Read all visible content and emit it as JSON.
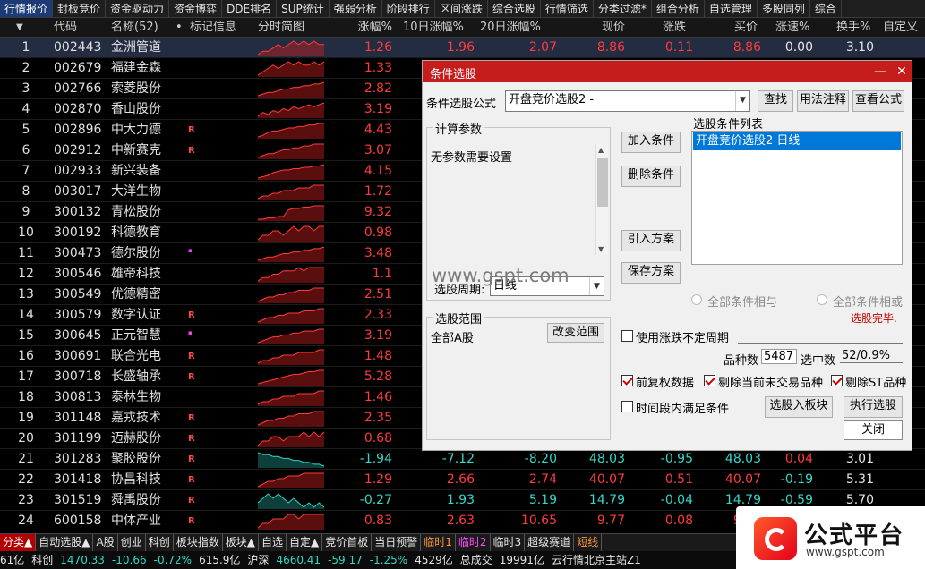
{
  "top_menu": [
    {
      "label": "行情报价",
      "active": true
    },
    {
      "label": "封板竞价"
    },
    {
      "label": "资金驱动力"
    },
    {
      "label": "资金博弈"
    },
    {
      "label": "DDE排名"
    },
    {
      "label": "SUP统计"
    },
    {
      "label": "强弱分析"
    },
    {
      "label": "阶段排行"
    },
    {
      "label": "区间涨跌"
    },
    {
      "label": "综合选股"
    },
    {
      "label": "行情筛选"
    },
    {
      "label": "分类过滤*"
    },
    {
      "label": "组合分析"
    },
    {
      "label": "自选管理"
    },
    {
      "label": "多股同列"
    },
    {
      "label": "综合"
    }
  ],
  "columns": [
    "代码",
    "名称(52)",
    "•",
    "标记信息",
    "分时简图",
    "涨幅%",
    "10日涨幅%",
    "20日涨幅%",
    "现价",
    "涨跌",
    "买价",
    "涨速%",
    "换手%",
    "自定义"
  ],
  "rows": [
    {
      "n": "1",
      "code": "002443",
      "name": "金洲管道",
      "mark": "",
      "chg": "1.26",
      "c10": "1.96",
      "c20": "2.07",
      "price": "8.86",
      "dif": "0.11",
      "bid": "8.86",
      "spd": "0.00",
      "turn": "3.10",
      "dir": "up",
      "spark": [
        3,
        4,
        4,
        5,
        6,
        5,
        6,
        7,
        6,
        7,
        6,
        7,
        6,
        6
      ]
    },
    {
      "n": "2",
      "code": "002679",
      "name": "福建金森",
      "mark": "",
      "chg": "1.33",
      "c10": "",
      "c20": "",
      "price": "",
      "dif": "",
      "bid": "",
      "spd": "",
      "turn": "",
      "dir": "up",
      "spark": [
        4,
        5,
        6,
        7,
        6,
        7,
        8,
        7,
        8,
        7,
        7,
        8,
        7,
        8
      ]
    },
    {
      "n": "3",
      "code": "002766",
      "name": "索菱股份",
      "mark": "",
      "chg": "2.82",
      "c10": "",
      "c20": "",
      "price": "",
      "dif": "",
      "bid": "",
      "spd": "",
      "turn": "",
      "dir": "up",
      "spark": [
        2,
        3,
        4,
        4,
        5,
        6,
        6,
        7,
        7,
        8,
        8,
        9,
        9,
        10
      ]
    },
    {
      "n": "4",
      "code": "002870",
      "name": "香山股份",
      "mark": "",
      "chg": "3.19",
      "c10": "",
      "c20": "",
      "price": "",
      "dif": "",
      "bid": "",
      "spd": "",
      "turn": "",
      "dir": "up",
      "spark": [
        3,
        5,
        4,
        6,
        5,
        7,
        6,
        8,
        7,
        8,
        9,
        8,
        9,
        10
      ]
    },
    {
      "n": "5",
      "code": "002896",
      "name": "中大力德",
      "mark": "R",
      "chg": "4.43",
      "c10": "",
      "c20": "",
      "price": "",
      "dif": "",
      "bid": "",
      "spd": "",
      "turn": "",
      "dir": "up",
      "spark": [
        2,
        3,
        5,
        6,
        6,
        7,
        8,
        8,
        9,
        9,
        10,
        10,
        11,
        11
      ]
    },
    {
      "n": "6",
      "code": "002912",
      "name": "中新赛克",
      "mark": "R",
      "chg": "3.07",
      "c10": "",
      "c20": "",
      "price": "",
      "dif": "",
      "bid": "",
      "spd": "",
      "turn": "",
      "dir": "up",
      "spark": [
        3,
        4,
        5,
        5,
        6,
        7,
        7,
        8,
        8,
        9,
        9,
        10,
        10,
        10
      ]
    },
    {
      "n": "7",
      "code": "002933",
      "name": "新兴装备",
      "mark": "",
      "chg": "4.15",
      "c10": "",
      "c20": "",
      "price": "",
      "dif": "",
      "bid": "",
      "spd": "",
      "turn": "",
      "dir": "up",
      "spark": [
        2,
        3,
        4,
        6,
        7,
        8,
        8,
        9,
        9,
        10,
        10,
        11,
        11,
        12
      ]
    },
    {
      "n": "8",
      "code": "003017",
      "name": "大洋生物",
      "mark": "",
      "chg": "1.72",
      "c10": "",
      "c20": "",
      "price": "",
      "dif": "",
      "bid": "",
      "spd": "",
      "turn": "",
      "dir": "up",
      "spark": [
        3,
        4,
        4,
        5,
        5,
        6,
        6,
        6,
        7,
        7,
        7,
        8,
        8,
        8
      ]
    },
    {
      "n": "9",
      "code": "300132",
      "name": "青松股份",
      "mark": "",
      "chg": "9.32",
      "c10": "",
      "c20": "",
      "price": "",
      "dif": "",
      "bid": "",
      "spd": "",
      "turn": "",
      "dir": "up",
      "spark": [
        2,
        2,
        3,
        3,
        4,
        4,
        9,
        10,
        10,
        11,
        11,
        12,
        12,
        12
      ]
    },
    {
      "n": "10",
      "code": "300192",
      "name": "科德教育",
      "mark": "",
      "chg": "0.98",
      "c10": "",
      "c20": "",
      "price": "",
      "dif": "",
      "bid": "",
      "spd": "",
      "turn": "",
      "dir": "up",
      "spark": [
        4,
        5,
        5,
        6,
        6,
        5,
        6,
        7,
        6,
        7,
        7,
        6,
        7,
        7
      ]
    },
    {
      "n": "11",
      "code": "300473",
      "name": "德尔股份",
      "mark": "dot",
      "chg": "3.48",
      "c10": "",
      "c20": "",
      "price": "",
      "dif": "",
      "bid": "",
      "spd": "",
      "turn": "",
      "dir": "up",
      "spark": [
        3,
        4,
        5,
        5,
        6,
        7,
        7,
        8,
        8,
        9,
        9,
        10,
        10,
        11
      ]
    },
    {
      "n": "12",
      "code": "300546",
      "name": "雄帝科技",
      "mark": "",
      "chg": "1.1",
      "c10": "",
      "c20": "",
      "price": "",
      "dif": "",
      "bid": "",
      "spd": "",
      "turn": "",
      "dir": "up",
      "spark": [
        3,
        4,
        4,
        5,
        5,
        6,
        6,
        6,
        7,
        6,
        7,
        7,
        7,
        7
      ]
    },
    {
      "n": "13",
      "code": "300549",
      "name": "优德精密",
      "mark": "",
      "chg": "2.51",
      "c10": "",
      "c20": "",
      "price": "",
      "dif": "",
      "bid": "",
      "spd": "",
      "turn": "",
      "dir": "up",
      "spark": [
        3,
        4,
        5,
        5,
        6,
        6,
        7,
        7,
        8,
        8,
        8,
        9,
        9,
        9
      ]
    },
    {
      "n": "14",
      "code": "300579",
      "name": "数字认证",
      "mark": "R",
      "chg": "2.33",
      "c10": "",
      "c20": "",
      "price": "",
      "dif": "",
      "bid": "",
      "spd": "",
      "turn": "",
      "dir": "up",
      "spark": [
        3,
        4,
        5,
        5,
        6,
        6,
        7,
        7,
        7,
        8,
        8,
        8,
        9,
        9
      ]
    },
    {
      "n": "15",
      "code": "300645",
      "name": "正元智慧",
      "mark": "dot",
      "chg": "3.19",
      "c10": "",
      "c20": "",
      "price": "",
      "dif": "",
      "bid": "",
      "spd": "",
      "turn": "",
      "dir": "up",
      "spark": [
        3,
        4,
        5,
        6,
        6,
        7,
        7,
        8,
        8,
        9,
        9,
        9,
        10,
        10
      ]
    },
    {
      "n": "16",
      "code": "300691",
      "name": "联合光电",
      "mark": "R",
      "chg": "1.48",
      "c10": "",
      "c20": "",
      "price": "",
      "dif": "",
      "bid": "",
      "spd": "",
      "turn": "",
      "dir": "up",
      "spark": [
        3,
        4,
        4,
        5,
        5,
        6,
        6,
        6,
        7,
        7,
        7,
        7,
        8,
        8
      ]
    },
    {
      "n": "17",
      "code": "300718",
      "name": "长盛轴承",
      "mark": "R",
      "chg": "5.28",
      "c10": "",
      "c20": "",
      "price": "",
      "dif": "",
      "bid": "",
      "spd": "",
      "turn": "",
      "dir": "up",
      "spark": [
        2,
        3,
        4,
        5,
        6,
        7,
        8,
        9,
        9,
        10,
        11,
        11,
        12,
        12
      ]
    },
    {
      "n": "18",
      "code": "300813",
      "name": "泰林生物",
      "mark": "",
      "chg": "1.46",
      "c10": "",
      "c20": "",
      "price": "",
      "dif": "",
      "bid": "",
      "spd": "",
      "turn": "",
      "dir": "up",
      "spark": [
        3,
        4,
        4,
        5,
        5,
        6,
        6,
        6,
        7,
        7,
        7,
        7,
        8,
        8
      ]
    },
    {
      "n": "19",
      "code": "301148",
      "name": "嘉戎技术",
      "mark": "R",
      "chg": "2.35",
      "c10": "",
      "c20": "",
      "price": "",
      "dif": "",
      "bid": "",
      "spd": "",
      "turn": "",
      "dir": "up",
      "spark": [
        3,
        4,
        5,
        5,
        6,
        6,
        7,
        7,
        8,
        8,
        8,
        9,
        9,
        9
      ]
    },
    {
      "n": "20",
      "code": "301199",
      "name": "迈赫股份",
      "mark": "R",
      "chg": "0.68",
      "c10": "",
      "c20": "",
      "price": "",
      "dif": "",
      "bid": "",
      "spd": "",
      "turn": "",
      "dir": "up",
      "spark": [
        4,
        5,
        5,
        6,
        6,
        5,
        6,
        6,
        6,
        7,
        6,
        7,
        6,
        7
      ]
    },
    {
      "n": "21",
      "code": "301283",
      "name": "聚胶股份",
      "mark": "R",
      "chg": "-1.94",
      "c10": "-7.12",
      "c20": "-8.20",
      "price": "48.03",
      "dif": "-0.95",
      "bid": "48.03",
      "spd": "0.04",
      "turn": "3.01",
      "dir": "down",
      "spark": [
        10,
        9,
        9,
        8,
        8,
        7,
        7,
        6,
        6,
        5,
        5,
        4,
        4,
        3
      ]
    },
    {
      "n": "22",
      "code": "301418",
      "name": "协昌科技",
      "mark": "R",
      "chg": "1.29",
      "c10": "2.66",
      "c20": "2.74",
      "price": "40.07",
      "dif": "0.51",
      "bid": "40.07",
      "spd": "-0.19",
      "turn": "5.31",
      "dir": "up",
      "spark": [
        3,
        4,
        5,
        5,
        6,
        6,
        7,
        7,
        7,
        8,
        8,
        8,
        8,
        8
      ]
    },
    {
      "n": "23",
      "code": "301519",
      "name": "舜禹股份",
      "mark": "R",
      "chg": "-0.27",
      "c10": "1.93",
      "c20": "5.19",
      "price": "14.79",
      "dif": "-0.04",
      "bid": "14.79",
      "spd": "-0.59",
      "turn": "5.70",
      "dir": "down",
      "spark": [
        7,
        8,
        9,
        8,
        9,
        8,
        7,
        8,
        7,
        6,
        7,
        6,
        7,
        6
      ]
    },
    {
      "n": "24",
      "code": "600158",
      "name": "中体产业",
      "mark": "R",
      "chg": "0.83",
      "c10": "2.63",
      "c20": "10.65",
      "price": "9.77",
      "dif": "0.08",
      "bid": "9.77",
      "spd": "0.00",
      "turn": "1.57",
      "dir": "up",
      "spark": [
        4,
        5,
        5,
        6,
        6,
        6,
        7,
        7,
        6,
        7,
        7,
        7,
        7,
        7
      ]
    }
  ],
  "bottom_tabs": [
    {
      "label": "分类▲",
      "style": "red"
    },
    {
      "label": "自动选股▲"
    },
    {
      "label": "A股"
    },
    {
      "label": "创业"
    },
    {
      "label": "科创"
    },
    {
      "label": "板块指数"
    },
    {
      "label": "板块▲"
    },
    {
      "label": "自选"
    },
    {
      "label": "自定▲"
    },
    {
      "label": "竞价首板"
    },
    {
      "label": "当日预警"
    },
    {
      "label": "临时1",
      "style": "org"
    },
    {
      "label": "临时2",
      "style": "mag"
    },
    {
      "label": "临时3"
    },
    {
      "label": "超级赛道"
    },
    {
      "label": "短线",
      "style": "org"
    }
  ],
  "status": [
    {
      "t": "61亿",
      "c": "wht"
    },
    {
      "t": "科创",
      "c": "wht"
    },
    {
      "t": "1470.33",
      "c": "grn"
    },
    {
      "t": "-10.66",
      "c": "grn"
    },
    {
      "t": "-0.72%",
      "c": "grn"
    },
    {
      "t": "615.9亿",
      "c": "wht"
    },
    {
      "t": "沪深",
      "c": "wht"
    },
    {
      "t": "4660.41",
      "c": "grn"
    },
    {
      "t": "-59.17",
      "c": "grn"
    },
    {
      "t": "-1.25%",
      "c": "grn"
    },
    {
      "t": "4529亿",
      "c": "wht"
    },
    {
      "t": "总成交",
      "c": "wht"
    },
    {
      "t": "19991亿",
      "c": "wht"
    },
    {
      "t": "云行情北京主站Z1",
      "c": "wht"
    }
  ],
  "dialog": {
    "title": "条件选股",
    "min_btn": "—",
    "close_btn": "✕",
    "formula_label": "条件选股公式",
    "formula_value": "开盘竞价选股2  -",
    "find_btn": "查找",
    "usage_btn": "用法注释",
    "view_btn": "查看公式",
    "params_group": "计算参数",
    "params_text": "无参数需要设置",
    "add_btn": "加入条件",
    "del_btn": "删除条件",
    "import_btn": "引入方案",
    "save_btn": "保存方案",
    "cond_list_label": "选股条件列表",
    "cond_items": [
      "开盘竞价选股2  日线"
    ],
    "period_label": "选股周期:",
    "period_value": "日线",
    "and_label": "全部条件相与",
    "or_label": "全部条件相或",
    "done_text": "选股完毕.",
    "scope_group": "选股范围",
    "scope_text": "全部A股",
    "change_scope_btn": "改变范围",
    "use_limit_label": "使用涨跌不定周期",
    "count_label": "品种数",
    "count_value": "5487",
    "selected_label": "选中数",
    "selected_value": "52/0.9%",
    "prior_label": "前复权数据",
    "exclude_untraded_label": "剔除当前未交易品种",
    "exclude_st_label": "剔除ST品种",
    "time_label": "时间段内满足条件",
    "to_block_btn": "选股入板块",
    "exec_btn": "执行选股",
    "close_label": "关闭"
  },
  "watermark": "www.gspt.com",
  "logo": {
    "title": "公式平台",
    "site": "www.gspt.com"
  },
  "colors": {
    "up": "#ff3c3c",
    "down": "#34d7c8",
    "dialog_title": "#c51c1c",
    "selection": "#0078d7"
  }
}
